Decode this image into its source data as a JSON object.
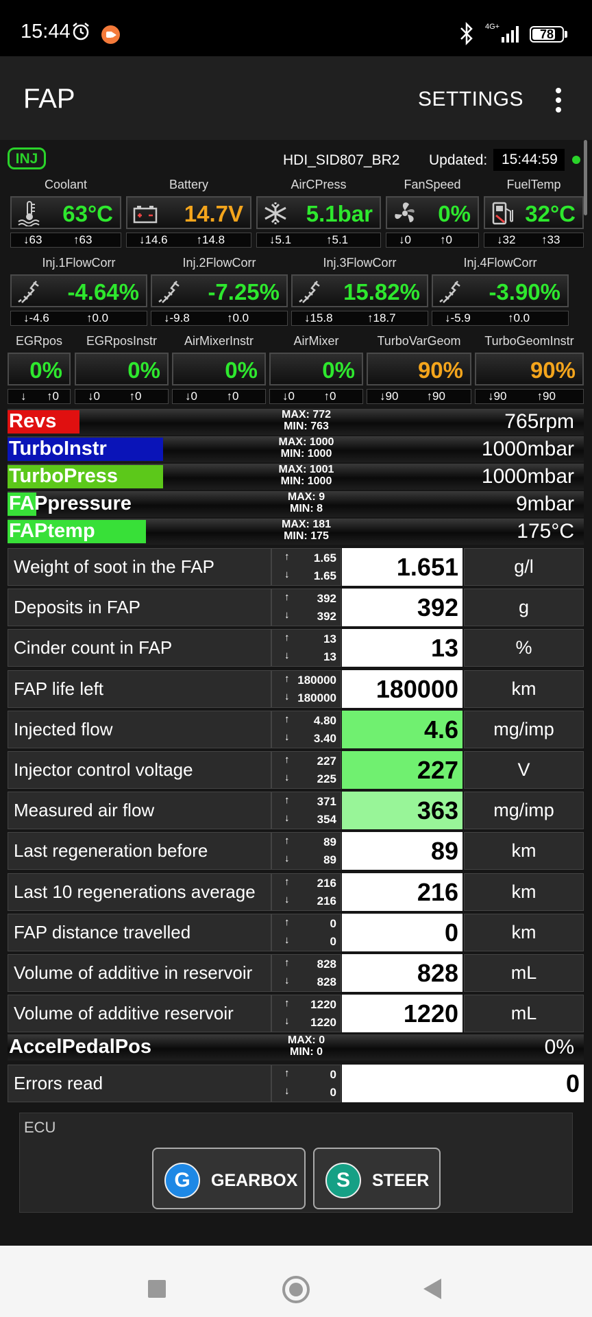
{
  "status_bar": {
    "time": "15:44",
    "network": "4G+",
    "battery": "78",
    "battery_level": 0.78
  },
  "app_bar": {
    "title": "FAP",
    "settings": "SETTINGS"
  },
  "header": {
    "badge": "INJ",
    "ecu": "HDI_SID807_BR2",
    "updated_label": "Updated:",
    "updated_time": "15:44:59"
  },
  "colors": {
    "green": "#2ee82e",
    "orange": "#f4a51c",
    "revs": "#e01010",
    "turbo_instr": "#0a14b8",
    "turbo_press": "#5cc81a",
    "fap": "#38e038",
    "pale_green": "#98f598",
    "mid_green": "#70f070"
  },
  "gauges_row1": [
    {
      "label": "Coolant",
      "value": "63°C",
      "min": "63",
      "max": "63",
      "icon": "thermometer-icon",
      "color": "#2ee82e"
    },
    {
      "label": "Battery",
      "value": "14.7V",
      "min": "14.6",
      "max": "14.8",
      "icon": "battery-icon",
      "color": "#f4a51c"
    },
    {
      "label": "AirCPress",
      "value": "5.1bar",
      "min": "5.1",
      "max": "5.1",
      "icon": "snowflake-icon",
      "color": "#2ee82e"
    },
    {
      "label": "FanSpeed",
      "value": "0%",
      "min": "0",
      "max": "0",
      "icon": "fan-icon",
      "color": "#2ee82e"
    },
    {
      "label": "FuelTemp",
      "value": "32°C",
      "min": "32",
      "max": "33",
      "icon": "fuel-pump-icon",
      "color": "#2ee82e"
    }
  ],
  "gauges_row2": [
    {
      "label": "Inj.1FlowCorr",
      "value": "-4.64%",
      "min": "-4.6",
      "max": "0.0",
      "icon": "injector-icon",
      "color": "#2ee82e"
    },
    {
      "label": "Inj.2FlowCorr",
      "value": "-7.25%",
      "min": "-9.8",
      "max": "0.0",
      "icon": "injector-icon",
      "color": "#2ee82e"
    },
    {
      "label": "Inj.3FlowCorr",
      "value": "15.82%",
      "min": "15.8",
      "max": "18.7",
      "icon": "injector-icon",
      "color": "#2ee82e"
    },
    {
      "label": "Inj.4FlowCorr",
      "value": "-3.90%",
      "min": "-5.9",
      "max": "0.0",
      "icon": "injector-icon",
      "color": "#2ee82e"
    }
  ],
  "gauges_row3": [
    {
      "label": "EGRpos",
      "value": "0%",
      "min": "",
      "max": "0",
      "color": "#2ee82e"
    },
    {
      "label": "EGRposInstr",
      "value": "0%",
      "min": "0",
      "max": "0",
      "color": "#2ee82e"
    },
    {
      "label": "AirMixerInstr",
      "value": "0%",
      "min": "0",
      "max": "0",
      "color": "#2ee82e"
    },
    {
      "label": "AirMixer",
      "value": "0%",
      "min": "0",
      "max": "0",
      "color": "#2ee82e"
    },
    {
      "label": "TurboVarGeom",
      "value": "90%",
      "min": "90",
      "max": "90",
      "color": "#f4a51c"
    },
    {
      "label": "TurboGeomInstr",
      "value": "90%",
      "min": "90",
      "max": "90",
      "color": "#f4a51c"
    }
  ],
  "bars": [
    {
      "name": "Revs",
      "max": "MAX: 772",
      "min": "MIN: 763",
      "value": "765rpm",
      "fill": 0.125,
      "color": "#e01010"
    },
    {
      "name": "TurboInstr",
      "max": "MAX: 1000",
      "min": "MIN: 1000",
      "value": "1000mbar",
      "fill": 0.27,
      "color": "#0a14b8"
    },
    {
      "name": "TurboPress",
      "max": "MAX: 1001",
      "min": "MIN: 1000",
      "value": "1000mbar",
      "fill": 0.27,
      "color": "#5cc81a"
    },
    {
      "name": "FAPpressure",
      "max": "MAX: 9",
      "min": "MIN: 8",
      "value": "9mbar",
      "fill": 0.05,
      "color": "#38e038"
    },
    {
      "name": "FAPtemp",
      "max": "MAX: 181",
      "min": "MIN: 175",
      "value": "175°C",
      "fill": 0.24,
      "color": "#38e038"
    }
  ],
  "params": [
    {
      "name": "Weight of soot in the FAP",
      "max": "1.65",
      "min": "1.65",
      "value": "1.651",
      "unit": "g/l",
      "bg": "#ffffff"
    },
    {
      "name": "Deposits in FAP",
      "max": "392",
      "min": "392",
      "value": "392",
      "unit": "g",
      "bg": "#ffffff"
    },
    {
      "name": "Cinder count in FAP",
      "max": "13",
      "min": "13",
      "value": "13",
      "unit": "%",
      "bg": "#ffffff"
    },
    {
      "name": "FAP life left",
      "max": "180000",
      "min": "180000",
      "value": "180000",
      "unit": "km",
      "bg": "#ffffff"
    },
    {
      "name": "Injected flow",
      "max": "4.80",
      "min": "3.40",
      "value": "4.6",
      "unit": "mg/imp",
      "bg": "#70f070"
    },
    {
      "name": "Injector control voltage",
      "max": "227",
      "min": "225",
      "value": "227",
      "unit": "V",
      "bg": "#70f070"
    },
    {
      "name": "Measured air flow",
      "max": "371",
      "min": "354",
      "value": "363",
      "unit": "mg/imp",
      "bg": "#98f598"
    },
    {
      "name": "Last regeneration before",
      "max": "89",
      "min": "89",
      "value": "89",
      "unit": "km",
      "bg": "#ffffff"
    },
    {
      "name": "Last 10 regenerations average",
      "max": "216",
      "min": "216",
      "value": "216",
      "unit": "km",
      "bg": "#ffffff"
    },
    {
      "name": "FAP distance travelled",
      "max": "0",
      "min": "0",
      "value": "0",
      "unit": "km",
      "bg": "#ffffff"
    },
    {
      "name": "Volume of additive in reservoir",
      "max": "828",
      "min": "828",
      "value": "828",
      "unit": "mL",
      "bg": "#ffffff"
    },
    {
      "name": "Volume of additive reservoir",
      "max": "1220",
      "min": "1220",
      "value": "1220",
      "unit": "mL",
      "bg": "#ffffff"
    }
  ],
  "accel_bar": {
    "name": "AccelPedalPos",
    "max": "MAX: 0",
    "min": "MIN: 0",
    "value": "0%",
    "fill": 0
  },
  "errors_row": {
    "name": "Errors read",
    "max": "0",
    "min": "0",
    "value": "0"
  },
  "ecu_panel": {
    "label": "ECU",
    "buttons": [
      {
        "letter": "G",
        "label": "GEARBOX",
        "color": "#1e88e5"
      },
      {
        "letter": "S",
        "label": "STEER",
        "color": "#16a085"
      }
    ]
  },
  "arrows": {
    "up": "↑",
    "down": "↓"
  }
}
